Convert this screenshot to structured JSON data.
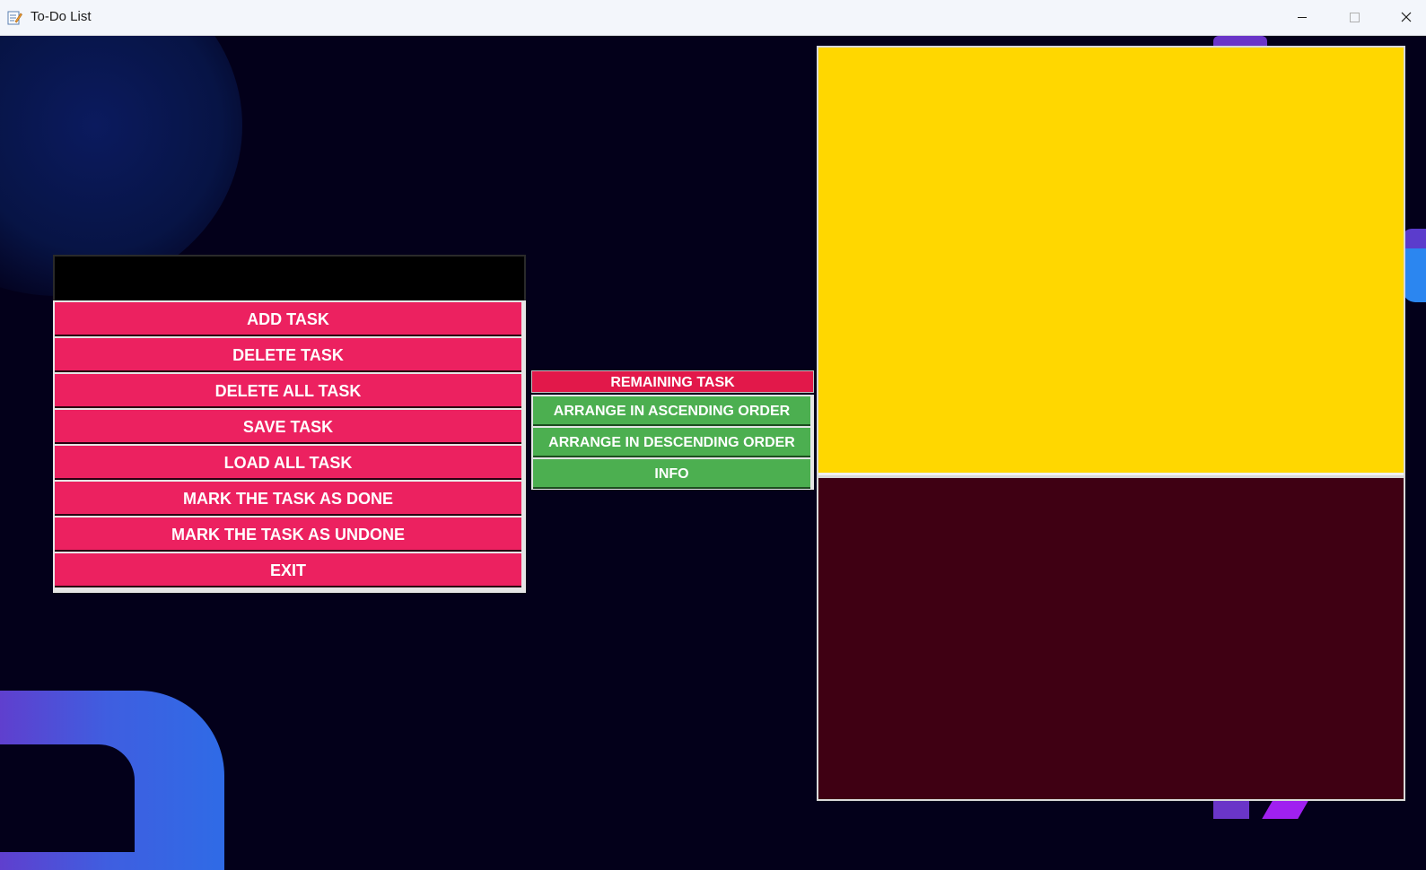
{
  "window": {
    "title": "To-Do List",
    "icons": [
      "notepad-icon",
      "minimize-icon",
      "maximize-icon",
      "close-icon"
    ]
  },
  "task_entry": {
    "value": ""
  },
  "buttons": {
    "add": "ADD TASK",
    "delete": "DELETE TASK",
    "delete_all": "DELETE ALL TASK",
    "save": "SAVE TASK",
    "load_all": "LOAD ALL TASK",
    "mark_done": "MARK THE TASK AS DONE",
    "mark_undone": "MARK THE TASK AS UNDONE",
    "exit": "EXIT"
  },
  "side_panel": {
    "remaining": "REMAINING TASK",
    "ascending": "ARRANGE IN ASCENDING ORDER",
    "descending": "ARRANGE IN DESCENDING ORDER",
    "info": "INFO"
  },
  "colors": {
    "background": "#03001a",
    "pink_button": "#ec2160",
    "remaining_red": "#e2184a",
    "green_button": "#4caf50",
    "task_list": "#ffd700",
    "done_list": "#3f0013"
  }
}
